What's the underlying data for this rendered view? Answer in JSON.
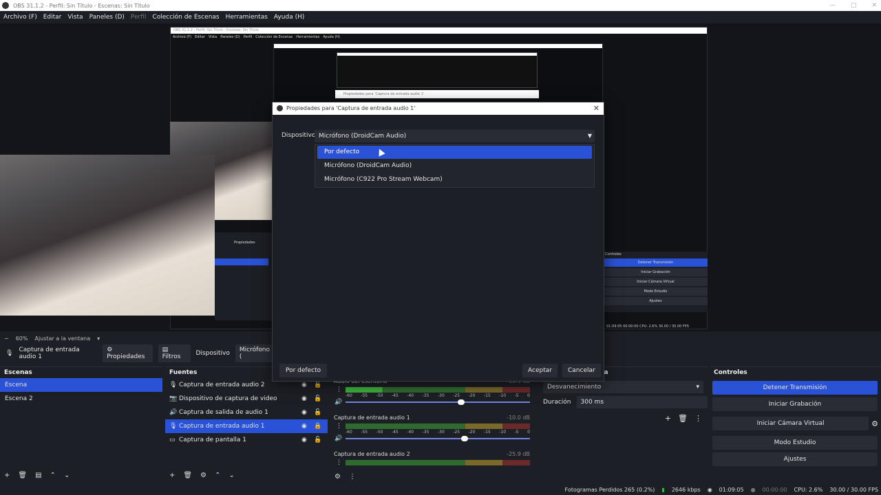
{
  "window": {
    "title": "OBS 31.1.2 - Perfil: Sin Título - Escenas: Sin Título"
  },
  "menu": [
    "Archivo (F)",
    "Editar",
    "Vista",
    "Paneles (D)",
    "Perfil",
    "Colección de Escenas",
    "Herramientas",
    "Ayuda (H)"
  ],
  "nested": {
    "title": "OBS 31.1.2 - Perfil: Sin Título - Escenas: Sin Título",
    "menu": [
      "Archivo (F)",
      "Editar",
      "Vista",
      "Paneles (D)",
      "Perfil",
      "Colección de Escenas",
      "Herramientas",
      "Ayuda (H)"
    ],
    "dialog_title": "Propiedades para 'Captura de entrada audio 1'",
    "props": "Propiedades",
    "controls_header": "Controles",
    "controls": [
      "Detener Transmisión",
      "Iniciar Grabación",
      "Iniciar Cámara Virtual",
      "Modo Estudio",
      "Ajustes"
    ],
    "status": "01:09:05   00:00:00   CPU: 2.6%   30.00 / 30.00 FPS"
  },
  "zoom": {
    "minus": "−",
    "value": "60%",
    "fit": "Ajustar a la ventana"
  },
  "source_toolbar": {
    "current_source": "Captura de entrada audio 1",
    "properties": "Propiedades",
    "filters": "Filtros",
    "device_label": "Dispositivo",
    "device_value": "Micrófono ("
  },
  "dialog": {
    "title": "Propiedades para 'Captura de entrada audio 1'",
    "device_label": "Dispositivo",
    "device_selected": "Micrófono (DroidCam Audio)",
    "options": [
      "Por defecto",
      "Micrófono (DroidCam Audio)",
      "Micrófono (C922 Pro Stream Webcam)"
    ],
    "highlighted_index": 0,
    "btn_default": "Por defecto",
    "btn_ok": "Aceptar",
    "btn_cancel": "Cancelar"
  },
  "scenes": {
    "header": "Escenas",
    "items": [
      "Escena",
      "Escena 2"
    ]
  },
  "sources": {
    "header": "Fuentes",
    "items": [
      {
        "name": "Captura de entrada audio 2",
        "icon": "microphone-icon"
      },
      {
        "name": "Dispositivo de captura de video",
        "icon": "camera-icon"
      },
      {
        "name": "Captura de salida de audio 1",
        "icon": "speaker-icon"
      },
      {
        "name": "Captura de entrada audio 1",
        "icon": "microphone-icon"
      },
      {
        "name": "Captura de pantalla 1",
        "icon": "monitor-icon"
      }
    ]
  },
  "mixer": {
    "channels": [
      {
        "name": "Audio del escritorio",
        "db": "-10.9 dB",
        "level": 0.22,
        "volume": 0.62
      },
      {
        "name": "Captura de entrada audio 1",
        "db": "-10.0 dB",
        "level": 0,
        "volume": 0.64
      },
      {
        "name": "Captura de entrada audio 2",
        "db": "-25.9 dB",
        "level": 0,
        "volume": 0.6
      }
    ],
    "scale": [
      "-60",
      "-55",
      "-50",
      "-45",
      "-40",
      "-35",
      "-30",
      "-25",
      "-20",
      "-15",
      "-10",
      "-5",
      "0"
    ]
  },
  "transitions": {
    "header": "ena",
    "type": "Desvanecimiento",
    "duration_label": "Duración",
    "duration_value": "300 ms"
  },
  "controls": {
    "header": "Controles",
    "stop_stream": "Detener Transmisión",
    "start_record": "Iniciar Grabación",
    "start_virtualcam": "Iniciar Cámara Virtual",
    "studio_mode": "Modo Estudio",
    "settings": "Ajustes"
  },
  "status": {
    "dropped": "Fotogramas Perdidos 265 (0.2%)",
    "bitrate": "2646 kbps",
    "stream_time": "01:09:05",
    "rec_time": "00:00:00",
    "cpu": "CPU: 2.6%",
    "fps": "30.00 / 30.00 FPS"
  },
  "colors": {
    "accent": "#2a52d6",
    "panel": "#1d1f26",
    "button": "#2a2c35"
  }
}
